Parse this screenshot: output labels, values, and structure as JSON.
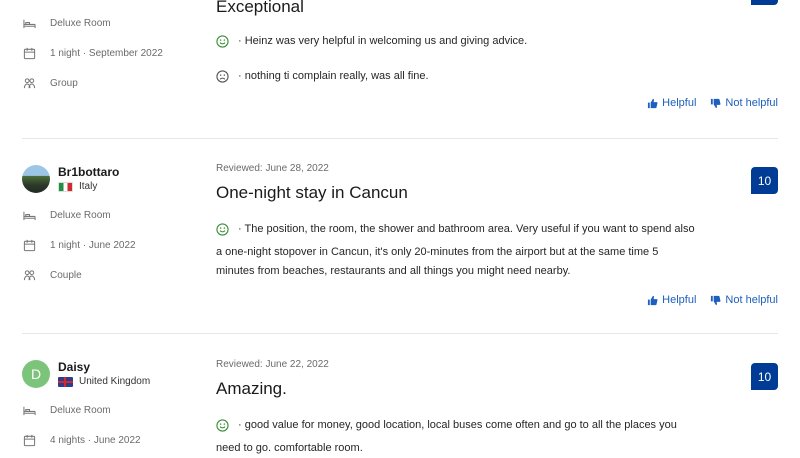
{
  "colors": {
    "link": "#1d5fbe",
    "score_bg": "#003b95",
    "positive_face": "#3a8f3a"
  },
  "reviews": [
    {
      "reviewer": {
        "name": "",
        "country": ""
      },
      "room": "Deluxe Room",
      "stay": "1 night · September 2022",
      "traveler": "Group",
      "reviewed": "",
      "title": "Exceptional",
      "positive": "· Heinz was very helpful in welcoming us and giving advice.",
      "negative": "· nothing ti complain really, was all fine.",
      "score": "",
      "helpful": "Helpful",
      "not_helpful": "Not helpful"
    },
    {
      "reviewer": {
        "name": "Br1bottaro",
        "country": "Italy"
      },
      "room": "Deluxe Room",
      "stay": "1 night · June 2022",
      "traveler": "Couple",
      "reviewed": "Reviewed: June 28, 2022",
      "title": "One-night stay in Cancun",
      "positive_lines": [
        "· The position, the room, the shower and bathroom area. Very useful if you want to spend also",
        "a one-night stopover in Cancun, it's only 20-minutes from the airport but at the same time 5",
        "minutes from beaches, restaurants and all things you might need nearby."
      ],
      "score": "10",
      "helpful": "Helpful",
      "not_helpful": "Not helpful"
    },
    {
      "reviewer": {
        "name": "Daisy",
        "initial": "D",
        "country": "United Kingdom"
      },
      "room": "Deluxe Room",
      "stay": "4 nights · June 2022",
      "reviewed": "Reviewed: June 22, 2022",
      "title": "Amazing.",
      "positive_lines": [
        "· good value for money, good location, local buses come often and go to all the places you",
        "need to go. comfortable room."
      ],
      "score": "10"
    }
  ]
}
